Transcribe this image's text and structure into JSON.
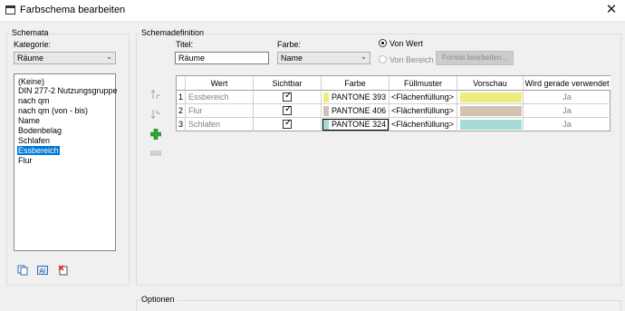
{
  "window": {
    "title": "Farbschema bearbeiten",
    "close_label": "✕"
  },
  "schemata": {
    "group_title": "Schemata",
    "kategorie_label": "Kategorie:",
    "kategorie_value": "Räume",
    "list": [
      "(Keine)",
      "DIN 277-2 Nutzungsgruppe",
      "nach qm",
      "nach qm (von - bis)",
      "Name",
      "Bodenbelag",
      "Schlafen",
      "Essbereich",
      "Flur"
    ],
    "selected_index": 7
  },
  "definition": {
    "group_title": "Schemadefinition",
    "titel_label": "Titel:",
    "titel_value": "Räume",
    "farbe_label": "Farbe:",
    "farbe_value": "Name",
    "radio_von_wert": "Von Wert",
    "radio_von_bereich": "Von Bereich",
    "format_button": "Format bearbeiten...",
    "table": {
      "headers": [
        "Wert",
        "Sichtbar",
        "Farbe",
        "Füllmuster",
        "Vorschau",
        "Wird gerade verwendet"
      ],
      "rows": [
        {
          "no": "1",
          "wert": "Essbereich",
          "sichtbar": true,
          "farbe": "PANTONE 393",
          "fill": "<Flächenfüllung>",
          "color": "#f0eb7d",
          "used": "Ja"
        },
        {
          "no": "2",
          "wert": "Flur",
          "sichtbar": true,
          "farbe": "PANTONE 406",
          "fill": "<Flächenfüllung>",
          "color": "#d1c2b4",
          "used": "Ja"
        },
        {
          "no": "3",
          "wert": "Schlafen",
          "sichtbar": true,
          "farbe": "PANTONE 324",
          "fill": "<Flächenfüllung>",
          "color": "#a5dcd5",
          "used": "Ja"
        }
      ]
    }
  },
  "optionen": {
    "group_title": "Optionen"
  },
  "icons": {
    "move_up": "move-up-icon",
    "move_down": "move-down-icon",
    "add": "add-icon",
    "remove": "remove-icon",
    "duplicate": "duplicate-icon",
    "rename": "rename-icon",
    "delete": "delete-icon"
  },
  "colors": {
    "selection": "#0078d7",
    "add_green": "#2fa82f"
  }
}
